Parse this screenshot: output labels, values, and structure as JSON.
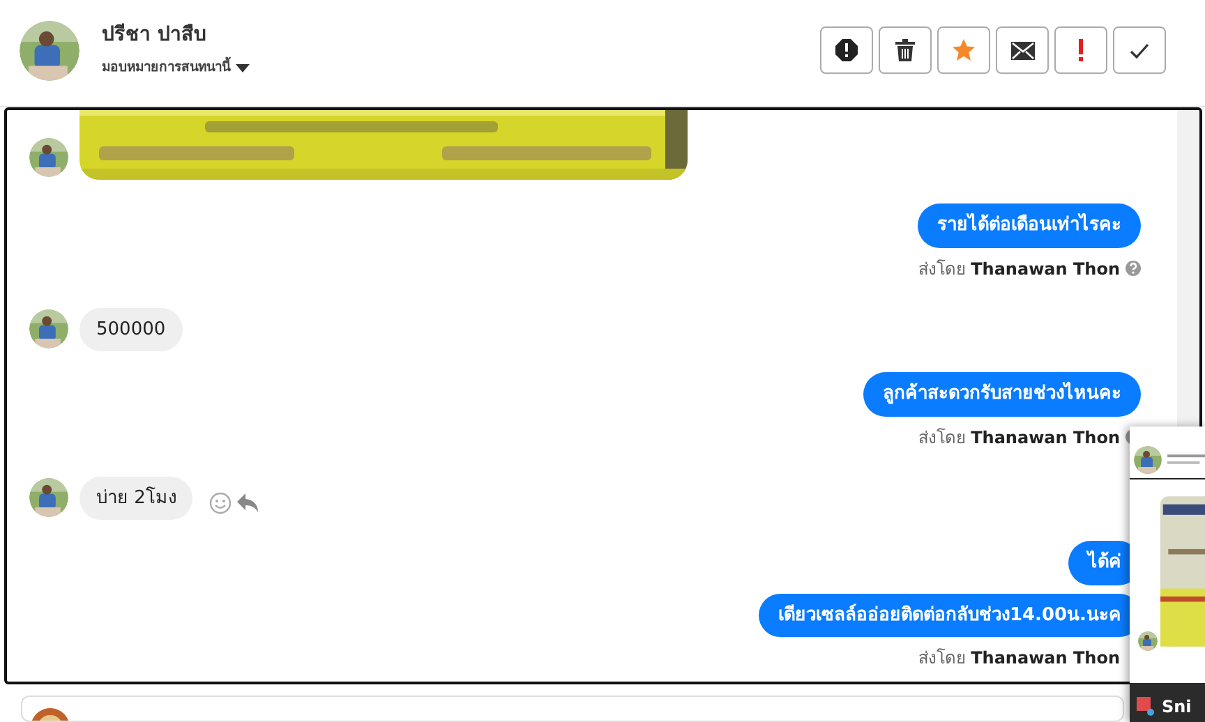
{
  "header": {
    "name": "ปรีชา ปาสืบ",
    "assign_label": "มอบหมายการสนทนานี้",
    "buttons": [
      {
        "kind": "report"
      },
      {
        "kind": "delete"
      },
      {
        "kind": "star"
      },
      {
        "kind": "mail"
      },
      {
        "kind": "urgent"
      },
      {
        "kind": "done"
      }
    ]
  },
  "messages": [
    {
      "kind": "picture"
    },
    {
      "kind": "outgoing",
      "text": "รายได้ต่อเดือนเท่าไรคะ"
    },
    {
      "kind": "sender",
      "prefix": "ส่งโดย",
      "name": "Thanawan Thon"
    },
    {
      "kind": "incoming",
      "text": "500000",
      "actions": false
    },
    {
      "kind": "outgoing",
      "text": "ลูกค้าสะดวกรับสายช่วงไหนคะ"
    },
    {
      "kind": "sender",
      "prefix": "ส่งโดย",
      "name": "Thanawan Thon"
    },
    {
      "kind": "incoming",
      "text": "บ่าย 2โมง",
      "actions": true
    },
    {
      "kind": "outgoing",
      "text": "ได้ค่"
    },
    {
      "kind": "outgoing",
      "text": "เดียวเซลล์ออ่อยติดต่อกลับช่วง14.00น.นะค"
    },
    {
      "kind": "sender",
      "prefix": "ส่งโดย",
      "name": "Thanawan Thon",
      "help_icon": false
    }
  ],
  "preview": {
    "app_label": "Sni"
  }
}
